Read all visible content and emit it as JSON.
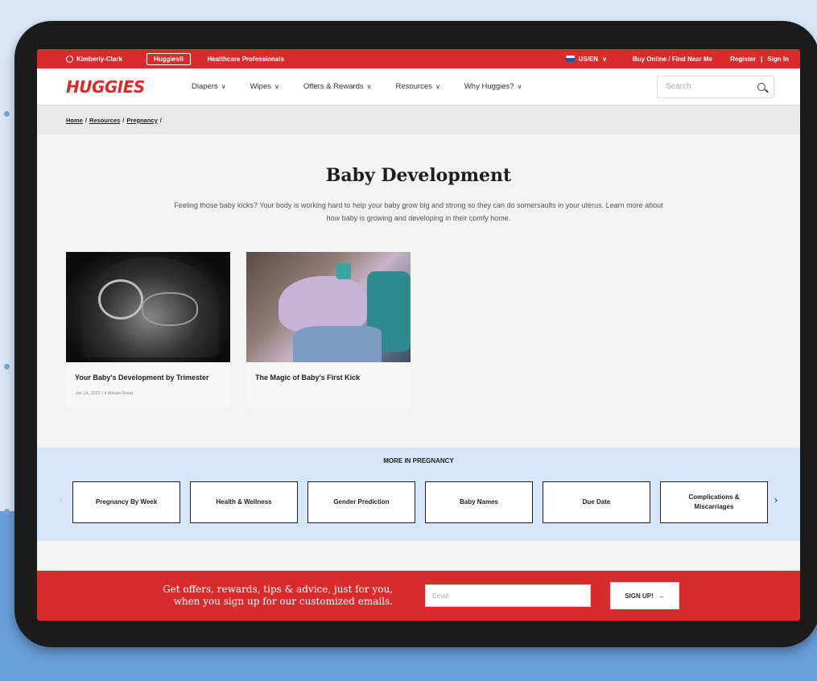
{
  "utility_bar": {
    "kc_label": "Kimberly-Clark",
    "huggies_pill": "Huggies®",
    "healthcare": "Healthcare Professionals",
    "locale": "US/EN",
    "buy_online": "Buy Online / Find Near Me",
    "register": "Register",
    "separator": "|",
    "sign_in": "Sign In"
  },
  "mainnav": {
    "logo": "HUGGIES",
    "items": [
      {
        "label": "Diapers"
      },
      {
        "label": "Wipes"
      },
      {
        "label": "Offers & Rewards"
      },
      {
        "label": "Resources"
      },
      {
        "label": "Why Huggies?"
      }
    ],
    "search_placeholder": "Search"
  },
  "breadcrumb": [
    "Home",
    "Resources",
    "Pregnancy"
  ],
  "breadcrumb_sep": "/",
  "hero": {
    "title": "Baby Development",
    "description": "Feeling those baby kicks? Your body is working hard to help your baby grow big and strong so they can do somersaults in your uterus. Learn more about how baby is growing and developing in their comfy home."
  },
  "cards": [
    {
      "title": "Your Baby's Development by Trimester",
      "meta": "Jan 14, 2022 | 4 Minute Read"
    },
    {
      "title": "The Magic of Baby's First Kick",
      "meta": ""
    }
  ],
  "more": {
    "title": "MORE IN PREGNANCY",
    "tiles": [
      {
        "label": "Pregnancy By Week"
      },
      {
        "label": "Health & Wellness"
      },
      {
        "label": "Gender Prediction"
      },
      {
        "label": "Baby Names"
      },
      {
        "label": "Due Date"
      },
      {
        "label": "Complications & Miscarriages"
      }
    ],
    "left_arrow": "‹",
    "right_arrow": "›"
  },
  "signup": {
    "line1": "Get offers, rewards, tips & advice, just for you,",
    "line2": "when you sign up for our customized emails.",
    "email_placeholder": "Email",
    "button": "SIGN UP!",
    "button_arrow": "→"
  },
  "icons": {
    "chevron": "∨"
  },
  "colors": {
    "brand_red": "#d92b2b",
    "more_bg": "#d6e5f7",
    "page_bg": "#f3f3f3"
  }
}
